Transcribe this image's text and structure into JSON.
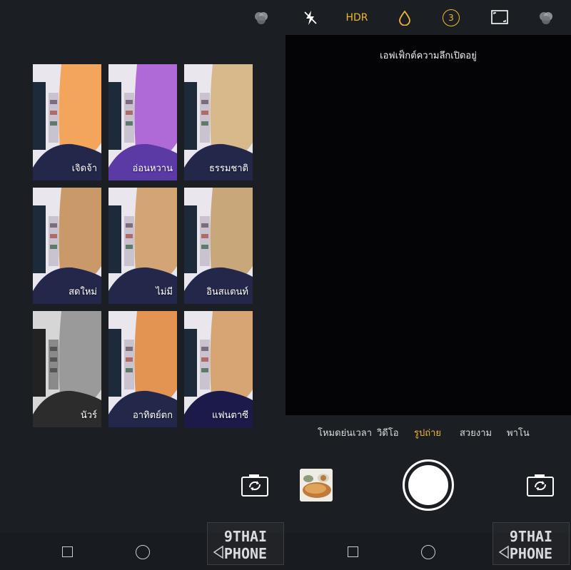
{
  "colors": {
    "background": "#1b1f24",
    "viewfinder": "#040406",
    "accent": "#f1b82d",
    "text": "#ffffff"
  },
  "left_panel": {
    "top_icon": "filter-circles-icon",
    "filters": [
      {
        "label": "เจิดจ้า",
        "tint": "#f3a55b"
      },
      {
        "label": "อ่อนหวาน",
        "tint": "#b06ad8"
      },
      {
        "label": "ธรรมชาติ",
        "tint": "#d7b98c"
      },
      {
        "label": "สดใหม่",
        "tint": "#c9996a"
      },
      {
        "label": "ไม่มี",
        "tint": "#d4a574"
      },
      {
        "label": "อินสแตนท์",
        "tint": "#c8a77b"
      },
      {
        "label": "นัวร์",
        "tint": "#9a9a9a"
      },
      {
        "label": "อาทิตย์ตก",
        "tint": "#e39452"
      },
      {
        "label": "แฟนตาซี",
        "tint": "#d7a573"
      }
    ],
    "camera_switch_icon": "switch-camera-icon",
    "watermark": {
      "line1": "9THAI",
      "line2": "PHONE"
    }
  },
  "right_panel": {
    "toolbar": {
      "flash_icon": "flash-off-icon",
      "hdr_label": "HDR",
      "drop_icon": "water-drop-icon",
      "timer_value": "3",
      "ratio_icon": "aspect-ratio-icon",
      "filter_icon": "filter-circles-icon"
    },
    "toast": "เอฟเฟ็กต์ความลึกเปิดอยู่",
    "modes": [
      {
        "label": "โหมดย่นเวลา",
        "active": false
      },
      {
        "label": "วิดีโอ",
        "active": false
      },
      {
        "label": "รูปถ่าย",
        "active": true
      },
      {
        "label": "สวยงาม",
        "active": false
      },
      {
        "label": "พาโน",
        "active": false
      }
    ],
    "shutter_icon": "shutter-button",
    "switch_icon": "switch-camera-icon",
    "watermark": {
      "line1": "9THAI",
      "line2": "PHONE"
    }
  },
  "nav": {
    "square": "recent-apps-icon",
    "circle": "home-icon",
    "back": "back-icon"
  }
}
